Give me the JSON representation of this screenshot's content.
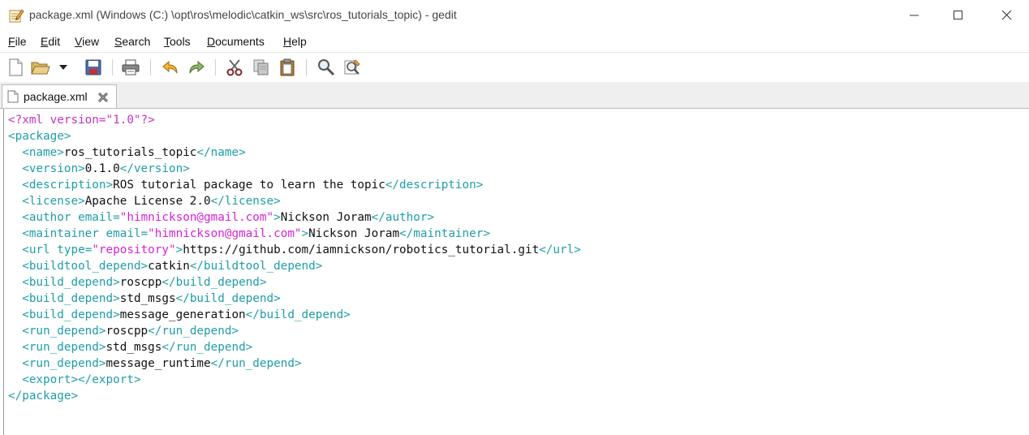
{
  "window": {
    "title": "package.xml (Windows (C:) \\opt\\ros\\melodic\\catkin_ws\\src\\ros_tutorials_topic) - gedit"
  },
  "menu": [
    {
      "access": "F",
      "rest": "ile"
    },
    {
      "access": "E",
      "rest": "dit"
    },
    {
      "access": "V",
      "rest": "iew"
    },
    {
      "access": "S",
      "rest": "earch"
    },
    {
      "access": "T",
      "rest": "ools"
    },
    {
      "access": "D",
      "rest": "ocuments"
    },
    {
      "access": "H",
      "rest": "elp"
    }
  ],
  "toolbar_icons": [
    "new-document-icon",
    "open-folder-icon",
    "open-dropdown-icon",
    "save-icon",
    "print-icon",
    "undo-icon",
    "redo-icon",
    "cut-icon",
    "copy-icon",
    "paste-icon",
    "find-icon",
    "find-replace-icon"
  ],
  "tab": {
    "label": "package.xml"
  },
  "code_lines": [
    [
      {
        "t": "pi",
        "v": "<?xml version=\"1.0\"?>"
      }
    ],
    [
      {
        "t": "tag",
        "v": "<package>"
      }
    ],
    [
      {
        "t": "txt",
        "v": "  "
      },
      {
        "t": "tag",
        "v": "<name>"
      },
      {
        "t": "txt",
        "v": "ros_tutorials_topic"
      },
      {
        "t": "tag",
        "v": "</name>"
      }
    ],
    [
      {
        "t": "txt",
        "v": "  "
      },
      {
        "t": "tag",
        "v": "<version>"
      },
      {
        "t": "txt",
        "v": "0.1.0"
      },
      {
        "t": "tag",
        "v": "</version>"
      }
    ],
    [
      {
        "t": "txt",
        "v": "  "
      },
      {
        "t": "tag",
        "v": "<description>"
      },
      {
        "t": "txt",
        "v": "ROS tutorial package to learn the topic"
      },
      {
        "t": "tag",
        "v": "</description>"
      }
    ],
    [
      {
        "t": "txt",
        "v": "  "
      },
      {
        "t": "tag",
        "v": "<license>"
      },
      {
        "t": "txt",
        "v": "Apache License 2.0"
      },
      {
        "t": "tag",
        "v": "</license>"
      }
    ],
    [
      {
        "t": "txt",
        "v": "  "
      },
      {
        "t": "tag",
        "v": "<author "
      },
      {
        "t": "attr",
        "v": "email="
      },
      {
        "t": "val",
        "v": "\"himnickson@gmail.com\""
      },
      {
        "t": "tag",
        "v": ">"
      },
      {
        "t": "txt",
        "v": "Nickson Joram"
      },
      {
        "t": "tag",
        "v": "</author>"
      }
    ],
    [
      {
        "t": "txt",
        "v": "  "
      },
      {
        "t": "tag",
        "v": "<maintainer "
      },
      {
        "t": "attr",
        "v": "email="
      },
      {
        "t": "val",
        "v": "\"himnickson@gmail.com\""
      },
      {
        "t": "tag",
        "v": ">"
      },
      {
        "t": "txt",
        "v": "Nickson Joram"
      },
      {
        "t": "tag",
        "v": "</maintainer>"
      }
    ],
    [
      {
        "t": "txt",
        "v": "  "
      },
      {
        "t": "tag",
        "v": "<url "
      },
      {
        "t": "attr",
        "v": "type="
      },
      {
        "t": "val",
        "v": "\"repository\""
      },
      {
        "t": "tag",
        "v": ">"
      },
      {
        "t": "txt",
        "v": "https://github.com/iamnickson/robotics_tutorial.git"
      },
      {
        "t": "tag",
        "v": "</url>"
      }
    ],
    [
      {
        "t": "txt",
        "v": "  "
      },
      {
        "t": "tag",
        "v": "<buildtool_depend>"
      },
      {
        "t": "txt",
        "v": "catkin"
      },
      {
        "t": "tag",
        "v": "</buildtool_depend>"
      }
    ],
    [
      {
        "t": "txt",
        "v": "  "
      },
      {
        "t": "tag",
        "v": "<build_depend>"
      },
      {
        "t": "txt",
        "v": "roscpp"
      },
      {
        "t": "tag",
        "v": "</build_depend>"
      }
    ],
    [
      {
        "t": "txt",
        "v": "  "
      },
      {
        "t": "tag",
        "v": "<build_depend>"
      },
      {
        "t": "txt",
        "v": "std_msgs"
      },
      {
        "t": "tag",
        "v": "</build_depend>"
      }
    ],
    [
      {
        "t": "txt",
        "v": "  "
      },
      {
        "t": "tag",
        "v": "<build_depend>"
      },
      {
        "t": "txt",
        "v": "message_generation"
      },
      {
        "t": "tag",
        "v": "</build_depend>"
      }
    ],
    [
      {
        "t": "txt",
        "v": "  "
      },
      {
        "t": "tag",
        "v": "<run_depend>"
      },
      {
        "t": "txt",
        "v": "roscpp"
      },
      {
        "t": "tag",
        "v": "</run_depend>"
      }
    ],
    [
      {
        "t": "txt",
        "v": "  "
      },
      {
        "t": "tag",
        "v": "<run_depend>"
      },
      {
        "t": "txt",
        "v": "std_msgs"
      },
      {
        "t": "tag",
        "v": "</run_depend>"
      }
    ],
    [
      {
        "t": "txt",
        "v": "  "
      },
      {
        "t": "tag",
        "v": "<run_depend>"
      },
      {
        "t": "txt",
        "v": "message_runtime"
      },
      {
        "t": "tag",
        "v": "</run_depend>"
      }
    ],
    [
      {
        "t": "txt",
        "v": "  "
      },
      {
        "t": "tag",
        "v": "<export></export>"
      }
    ],
    [
      {
        "t": "tag",
        "v": "</package>"
      }
    ]
  ],
  "colors": {
    "tag": "#1f9da8",
    "processing_instruction": "#c433c4",
    "attribute_value": "#d523d5",
    "text": "#111111"
  }
}
